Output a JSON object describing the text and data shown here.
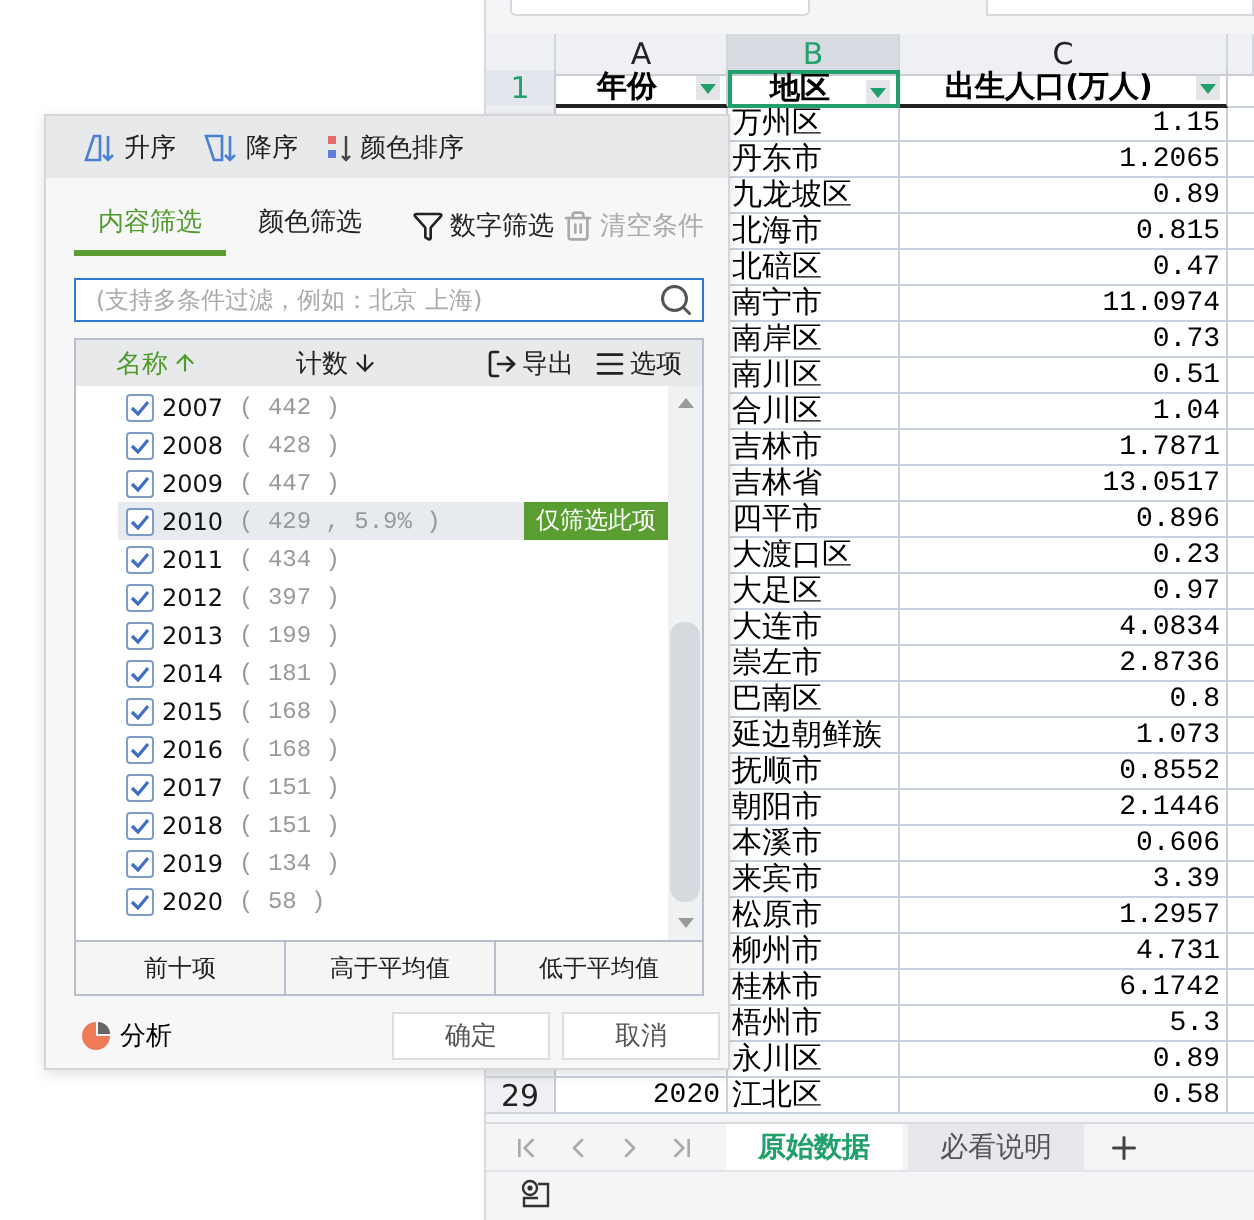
{
  "sheet": {
    "columns": [
      {
        "label": "A",
        "selected": false
      },
      {
        "label": "B",
        "selected": true
      },
      {
        "label": "C",
        "selected": false
      }
    ],
    "header_row": {
      "row": "1",
      "cells": [
        "年份",
        "地区",
        "出生人口(万人)"
      ]
    },
    "rows": [
      {
        "region": "万州区",
        "births": "1.15"
      },
      {
        "region": "丹东市",
        "births": "1.2065"
      },
      {
        "region": "九龙坡区",
        "births": "0.89"
      },
      {
        "region": "北海市",
        "births": "0.815"
      },
      {
        "region": "北碚区",
        "births": "0.47"
      },
      {
        "region": "南宁市",
        "births": "11.0974"
      },
      {
        "region": "南岸区",
        "births": "0.73"
      },
      {
        "region": "南川区",
        "births": "0.51"
      },
      {
        "region": "合川区",
        "births": "1.04"
      },
      {
        "region": "吉林市",
        "births": "1.7871"
      },
      {
        "region": "吉林省",
        "births": "13.0517"
      },
      {
        "region": "四平市",
        "births": "0.896"
      },
      {
        "region": "大渡口区",
        "births": "0.23"
      },
      {
        "region": "大足区",
        "births": "0.97"
      },
      {
        "region": "大连市",
        "births": "4.0834"
      },
      {
        "region": "崇左市",
        "births": "2.8736"
      },
      {
        "region": "巴南区",
        "births": "0.8"
      },
      {
        "region": "延边朝鲜族",
        "births": "1.073"
      },
      {
        "region": "抚顺市",
        "births": "0.8552"
      },
      {
        "region": "朝阳市",
        "births": "2.1446"
      },
      {
        "region": "本溪市",
        "births": "0.606"
      },
      {
        "region": "来宾市",
        "births": "3.39"
      },
      {
        "region": "松原市",
        "births": "1.2957"
      },
      {
        "region": "柳州市",
        "births": "4.731"
      },
      {
        "region": "桂林市",
        "births": "6.1742"
      },
      {
        "region": "梧州市",
        "births": "5.3"
      },
      {
        "region": "永川区",
        "births": "0.89"
      },
      {
        "row": "29",
        "year": "2020",
        "region": "江北区",
        "births": "0.58"
      }
    ],
    "sheet_tabs": [
      {
        "label": "原始数据",
        "selected": true
      },
      {
        "label": "必看说明",
        "selected": false
      }
    ]
  },
  "filter_popup": {
    "sort_buttons": [
      "升序",
      "降序",
      "颜色排序"
    ],
    "tabs": [
      {
        "label": "内容筛选",
        "selected": true
      },
      {
        "label": "颜色筛选",
        "selected": false
      }
    ],
    "number_filter": "数字筛选",
    "clear": {
      "label": "清空条件",
      "disabled": true
    },
    "search": {
      "placeholder": "(支持多条件过滤，例如：北京 上海)"
    },
    "list_header": {
      "name": "名称",
      "count": "计数",
      "export": "导出",
      "options": "选项"
    },
    "items": [
      {
        "label": "2007",
        "count": "( 442 )",
        "checked": true,
        "hovered": false
      },
      {
        "label": "2008",
        "count": "( 428 )",
        "checked": true,
        "hovered": false
      },
      {
        "label": "2009",
        "count": "( 447 )",
        "checked": true,
        "hovered": false
      },
      {
        "label": "2010",
        "count": "( 429 , 5.9% )",
        "checked": true,
        "hovered": true,
        "action": "仅筛选此项"
      },
      {
        "label": "2011",
        "count": "( 434 )",
        "checked": true,
        "hovered": false
      },
      {
        "label": "2012",
        "count": "( 397 )",
        "checked": true,
        "hovered": false
      },
      {
        "label": "2013",
        "count": "( 199 )",
        "checked": true,
        "hovered": false
      },
      {
        "label": "2014",
        "count": "( 181 )",
        "checked": true,
        "hovered": false
      },
      {
        "label": "2015",
        "count": "( 168 )",
        "checked": true,
        "hovered": false
      },
      {
        "label": "2016",
        "count": "( 168 )",
        "checked": true,
        "hovered": false
      },
      {
        "label": "2017",
        "count": "( 151 )",
        "checked": true,
        "hovered": false
      },
      {
        "label": "2018",
        "count": "( 151 )",
        "checked": true,
        "hovered": false
      },
      {
        "label": "2019",
        "count": "( 134 )",
        "checked": true,
        "hovered": false
      },
      {
        "label": "2020",
        "count": "( 58 )",
        "checked": true,
        "hovered": false
      }
    ],
    "quick_filters": [
      "前十项",
      "高于平均值",
      "低于平均值"
    ],
    "analyze": "分析",
    "ok": "确定",
    "cancel": "取消"
  }
}
